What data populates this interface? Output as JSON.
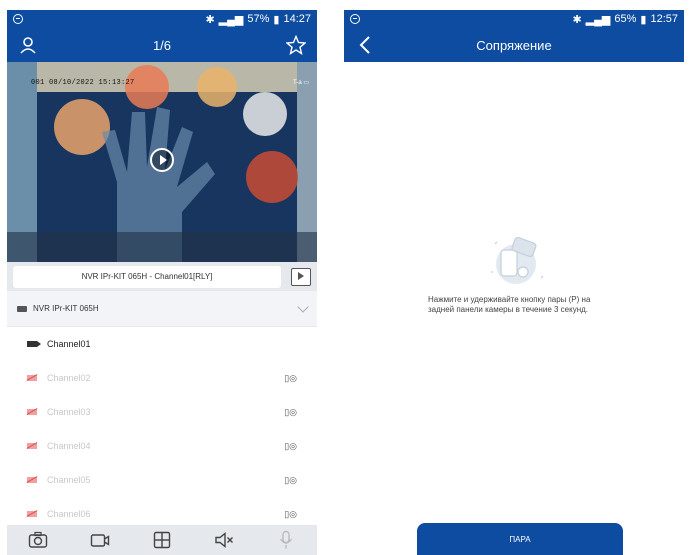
{
  "left": {
    "status": {
      "battery": "57%",
      "time": "14:27"
    },
    "header": {
      "title": "1/6"
    },
    "video": {
      "osd_timestamp": "001 08/10/2022 15:13:27",
      "osd_right": "T-a ▭"
    },
    "channel_bar": {
      "label": "NVR IPr-KIT 065H - Channel01[RLY]"
    },
    "device": {
      "name": "NVR IPr-KIT 065H"
    },
    "channels": [
      {
        "label": "Channel01",
        "active": true
      },
      {
        "label": "Channel02",
        "active": false
      },
      {
        "label": "Channel03",
        "active": false
      },
      {
        "label": "Channel04",
        "active": false
      },
      {
        "label": "Channel05",
        "active": false
      },
      {
        "label": "Channel06",
        "active": false
      }
    ],
    "pair_glyph": "▯◎",
    "toolbar": [
      "snapshot-icon",
      "record-icon",
      "grid-icon",
      "mute-icon",
      "mic-icon"
    ]
  },
  "right": {
    "status": {
      "battery": "65%",
      "time": "12:57"
    },
    "header": {
      "title": "Сопряжение"
    },
    "instruction": "Нажмите и удерживайте кнопку пары (P) на задней панели камеры в течение 3 секунд.",
    "pair_button": "ПАРА"
  },
  "colors": {
    "primary": "#0d4ca1",
    "toolbar_bg": "#e5e8ed",
    "disabled_text": "#c8c8c8",
    "off_icon": "#d44444"
  }
}
